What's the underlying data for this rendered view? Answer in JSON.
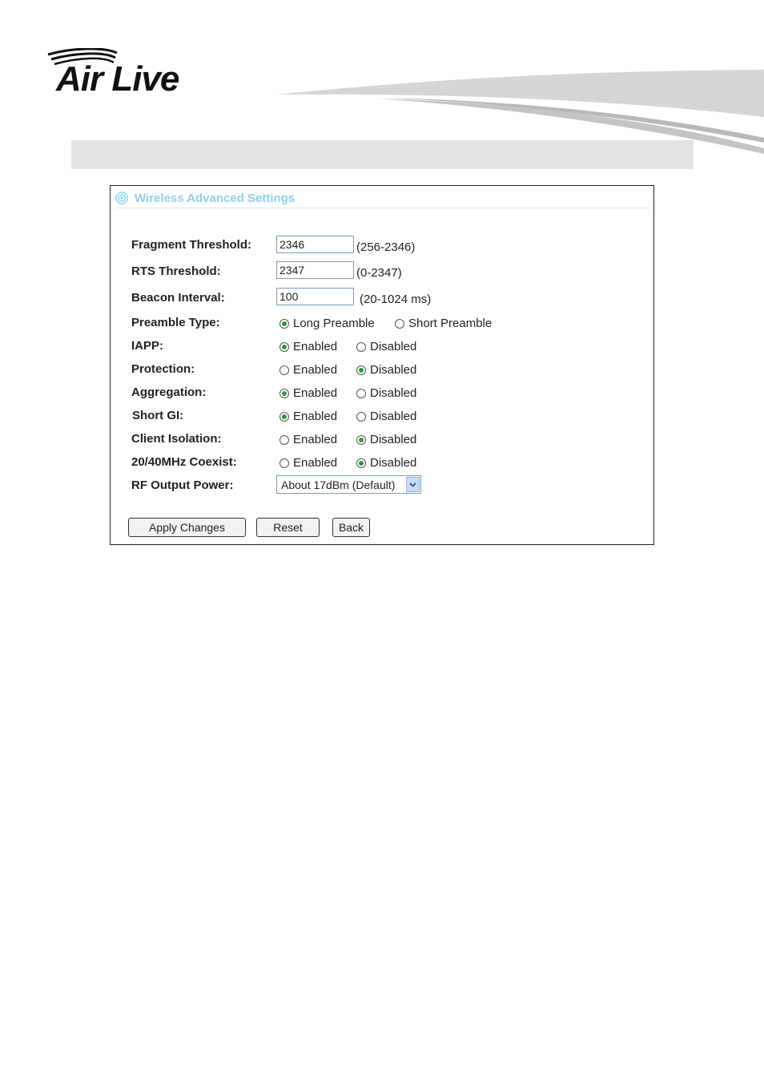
{
  "brand": {
    "logo_text": "Air Live"
  },
  "panel": {
    "title": "Wireless Advanced Settings",
    "fields": {
      "fragment": {
        "label": "Fragment Threshold:",
        "value": "2346",
        "range": "(256-2346)"
      },
      "rts": {
        "label": "RTS Threshold:",
        "value": "2347",
        "range": "(0-2347)"
      },
      "beacon": {
        "label": "Beacon Interval:",
        "value": "100",
        "range": "(20-1024 ms)"
      }
    },
    "preamble": {
      "label": "Preamble Type:",
      "options": [
        "Long Preamble",
        "Short Preamble"
      ],
      "selected": "Long Preamble"
    },
    "toggles": [
      {
        "label": "IAPP:",
        "selected": "Enabled"
      },
      {
        "label": "Protection:",
        "selected": "Disabled"
      },
      {
        "label": "Aggregation:",
        "selected": "Enabled"
      },
      {
        "label": "Short GI:",
        "selected": "Enabled"
      },
      {
        "label": "Client Isolation:",
        "selected": "Disabled"
      },
      {
        "label": "20/40MHz Coexist:",
        "selected": "Disabled"
      }
    ],
    "option_labels": {
      "enabled": "Enabled",
      "disabled": "Disabled"
    },
    "rf_power": {
      "label": "RF Output Power:",
      "value": "About 17dBm (Default)"
    },
    "buttons": {
      "apply": "Apply Changes",
      "reset": "Reset",
      "back": "Back"
    }
  },
  "colors": {
    "title": "#8fd0ef",
    "radio_dot": "#2a9a3a",
    "gray_bar": "#e3e3e3"
  }
}
